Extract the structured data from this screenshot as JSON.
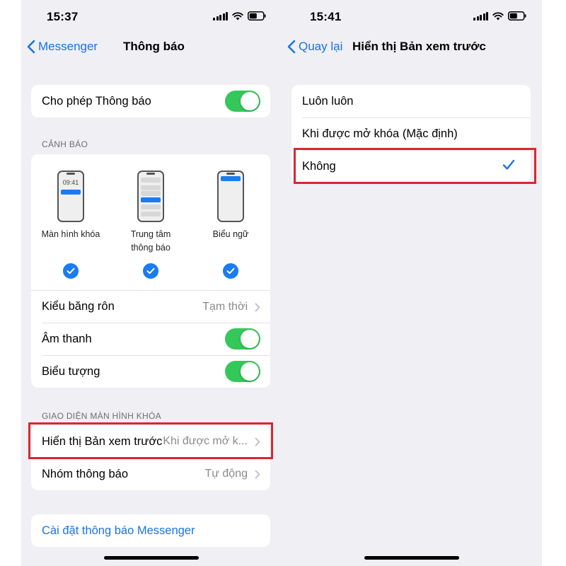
{
  "left_screen": {
    "time": "15:37",
    "back_label": "Messenger",
    "title": "Thông báo",
    "allow_notifications": {
      "label": "Cho phép Thông báo",
      "on": true
    },
    "alerts_header": "CẢNH BÁO",
    "alerts": [
      {
        "label": "Màn hình khóa",
        "checked": true,
        "clock": "09:41"
      },
      {
        "label": "Trung tâm\nthông báo",
        "checked": true
      },
      {
        "label": "Biểu ngữ",
        "checked": true
      }
    ],
    "banner_style": {
      "label": "Kiểu băng rôn",
      "value": "Tạm thời"
    },
    "sounds": {
      "label": "Âm thanh",
      "on": true
    },
    "badges": {
      "label": "Biểu tượng",
      "on": true
    },
    "lock_screen_header": "GIAO DIỆN MÀN HÌNH KHÓA",
    "show_previews": {
      "label": "Hiển thị Bản xem trước",
      "value": "Khi được mở k..."
    },
    "grouping": {
      "label": "Nhóm thông báo",
      "value": "Tự động"
    },
    "app_settings_link": "Cài đặt thông báo Messenger"
  },
  "right_screen": {
    "time": "15:41",
    "back_label": "Quay lại",
    "title": "Hiển thị Bản xem trước",
    "options": [
      {
        "label": "Luôn luôn",
        "selected": false
      },
      {
        "label": "Khi được mở khóa (Mặc định)",
        "selected": false
      },
      {
        "label": "Không",
        "selected": true
      }
    ]
  },
  "colors": {
    "accent": "#1a73e8",
    "toggle_on": "#34c759",
    "highlight": "#d62830",
    "background": "#efeff4"
  }
}
